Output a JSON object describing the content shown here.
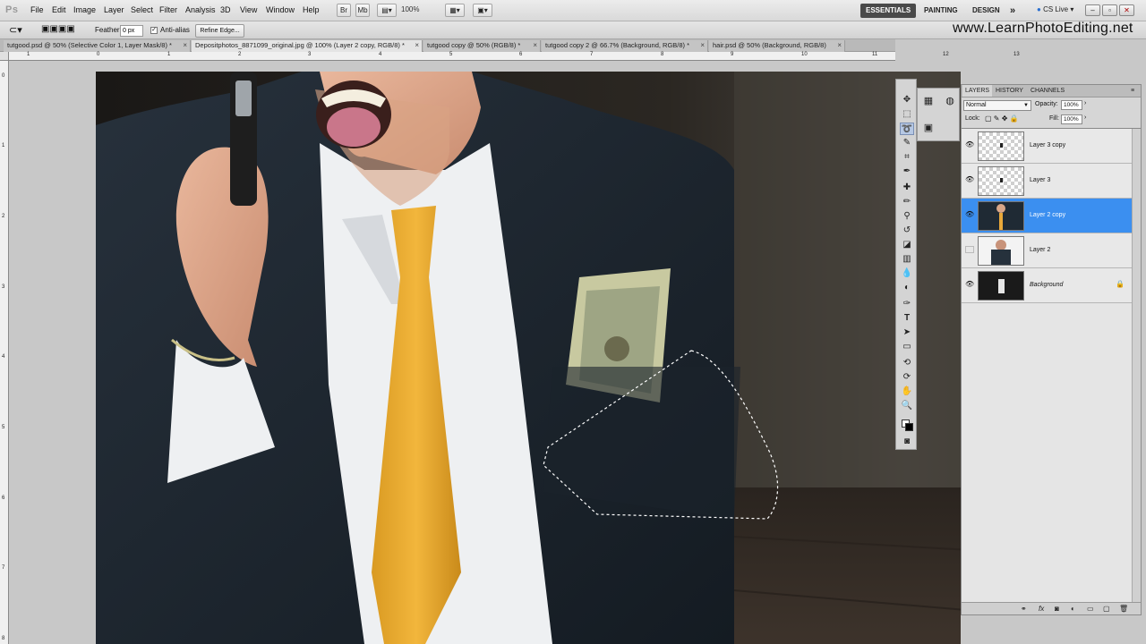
{
  "app": {
    "logo": "Ps"
  },
  "menu": [
    "File",
    "Edit",
    "Image",
    "Layer",
    "Select",
    "Filter",
    "Analysis",
    "3D",
    "View",
    "Window",
    "Help"
  ],
  "menubar": {
    "bridge_label": "Br",
    "minibridge_label": "Mb",
    "zoom": "100%",
    "workspaces": [
      "ESSENTIALS",
      "PAINTING",
      "DESIGN"
    ],
    "more": "»",
    "cslive": "CS Live"
  },
  "options": {
    "feather_label": "Feather:",
    "feather_value": "0 px",
    "antialias_label": "Anti-alias",
    "antialias_checked": true,
    "refine_edge": "Refine Edge..."
  },
  "watermark": "www.LearnPhotoEditing.net",
  "tabs": [
    {
      "label": "tutgood.psd @ 50% (Selective Color 1, Layer Mask/8) *",
      "active": false
    },
    {
      "label": "Depositphotos_8871099_original.jpg @ 100% (Layer 2 copy, RGB/8) *",
      "active": true
    },
    {
      "label": "tutgood copy @ 50% (RGB/8) *",
      "active": false
    },
    {
      "label": "tutgood copy 2 @ 66.7% (Background, RGB/8) *",
      "active": false
    },
    {
      "label": "hair.psd @ 50% (Background, RGB/8)",
      "active": false
    }
  ],
  "ruler_h": [
    "1",
    "0",
    "1",
    "2",
    "3",
    "4",
    "5",
    "6",
    "7",
    "8",
    "9",
    "10",
    "11",
    "12",
    "13"
  ],
  "ruler_v": [
    "0",
    "1",
    "2",
    "3",
    "4",
    "5",
    "6",
    "7",
    "8"
  ],
  "layers_panel": {
    "tabs": [
      "LAYERS",
      "HISTORY",
      "CHANNELS"
    ],
    "blend_mode": "Normal",
    "opacity_label": "Opacity:",
    "opacity": "100%",
    "lock_label": "Lock:",
    "fill_label": "Fill:",
    "fill": "100%",
    "layers": [
      {
        "name": "Layer 3 copy",
        "visible": true,
        "selected": false,
        "thumb": "transparent"
      },
      {
        "name": "Layer 3",
        "visible": true,
        "selected": false,
        "thumb": "transparent"
      },
      {
        "name": "Layer 2 copy",
        "visible": true,
        "selected": true,
        "thumb": "photo"
      },
      {
        "name": "Layer 2",
        "visible": false,
        "selected": false,
        "thumb": "photo"
      },
      {
        "name": "Background",
        "visible": true,
        "selected": false,
        "thumb": "dark",
        "locked": true
      }
    ]
  },
  "colors": {
    "selection": "#3b8ff0",
    "accent": "#4a4a4a"
  }
}
